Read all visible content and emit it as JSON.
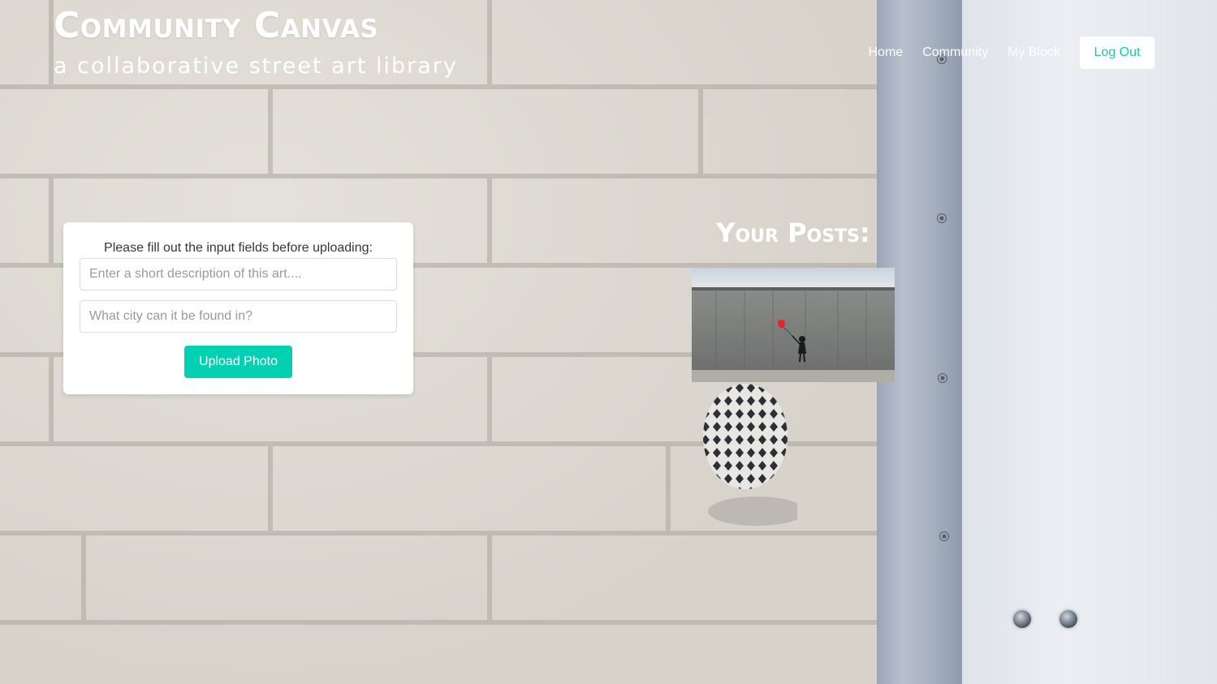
{
  "header": {
    "title": "Community Canvas",
    "subtitle": "a collaborative street art library"
  },
  "nav": {
    "items": [
      {
        "label": "Home"
      },
      {
        "label": "Community"
      },
      {
        "label": "My Block"
      }
    ],
    "logout_label": "Log Out"
  },
  "upload_form": {
    "instructions": "Please fill out the input fields before uploading:",
    "description_placeholder": "Enter a short description of this art....",
    "city_placeholder": "What city can it be found in?",
    "upload_label": "Upload Photo"
  },
  "posts": {
    "heading": "Your Posts:"
  },
  "colors": {
    "accent": "#00d1b2",
    "logout_text": "#1fc7a7"
  }
}
